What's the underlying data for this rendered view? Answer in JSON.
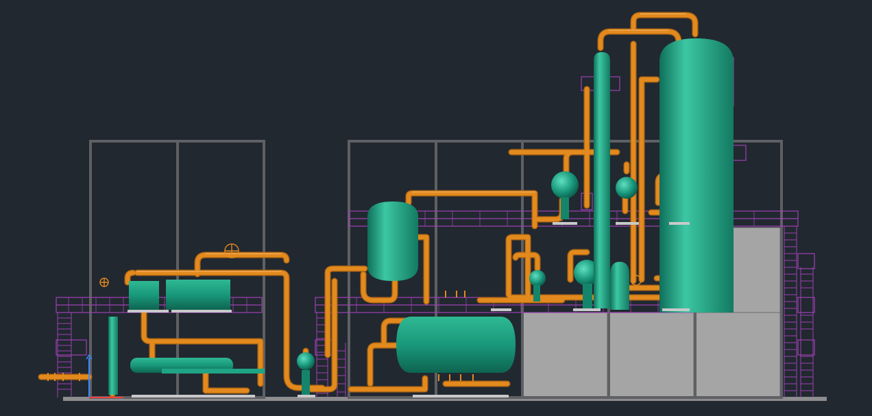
{
  "colors": {
    "background": "#212830",
    "frame": "#5f6063",
    "panel": "#a5a5a6",
    "pipe": "#e28a1e",
    "pipe_highlight": "#f3b264",
    "vessel": "#18967b",
    "vessel_highlight": "#38c3a0",
    "platform": "#a040b4",
    "ground": "#8d8d8f"
  },
  "icons": {
    "ucs": "ucs-axis-icon",
    "handwheel": "valve-handwheel-icon"
  }
}
